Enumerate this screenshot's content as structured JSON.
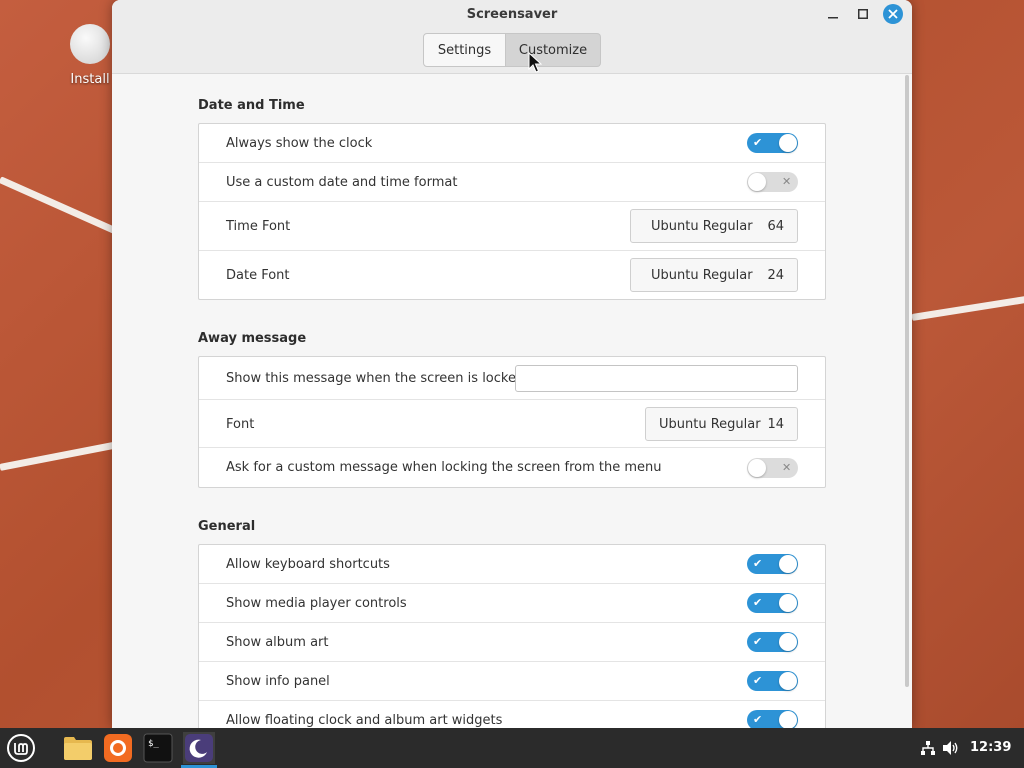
{
  "desktop": {
    "icon_label": "Install"
  },
  "window": {
    "title": "Screensaver",
    "tabs": [
      {
        "label": "Settings",
        "active": false
      },
      {
        "label": "Customize",
        "active": true
      }
    ]
  },
  "sections": {
    "date_time": {
      "title": "Date and Time",
      "rows": {
        "always_clock": {
          "label": "Always show the clock",
          "enabled": true
        },
        "custom_format": {
          "label": "Use a custom date and time format",
          "enabled": false
        },
        "time_font": {
          "label": "Time Font",
          "font": "Ubuntu Regular",
          "size": "64"
        },
        "date_font": {
          "label": "Date Font",
          "font": "Ubuntu Regular",
          "size": "24"
        }
      }
    },
    "away": {
      "title": "Away message",
      "rows": {
        "message": {
          "label": "Show this message when the screen is locked",
          "value": ""
        },
        "font": {
          "label": "Font",
          "font": "Ubuntu Regular",
          "size": "14"
        },
        "ask_custom": {
          "label": "Ask for a custom message when locking the screen from the menu",
          "enabled": false
        }
      }
    },
    "general": {
      "title": "General",
      "rows": {
        "keyboard": {
          "label": "Allow keyboard shortcuts",
          "enabled": true
        },
        "media": {
          "label": "Show media player controls",
          "enabled": true
        },
        "album": {
          "label": "Show album art",
          "enabled": true
        },
        "info": {
          "label": "Show info panel",
          "enabled": true
        },
        "floating": {
          "label": "Allow floating clock and album art widgets",
          "enabled": true
        }
      }
    }
  },
  "taskbar": {
    "clock": "12:39",
    "apps": [
      "menu-icon",
      "files-icon",
      "firefox-icon",
      "terminal-icon",
      "screensaver-icon"
    ]
  },
  "colors": {
    "accent": "#2d93d6",
    "wallpaper": "#b8573a",
    "taskbar": "#2b2b2b"
  }
}
